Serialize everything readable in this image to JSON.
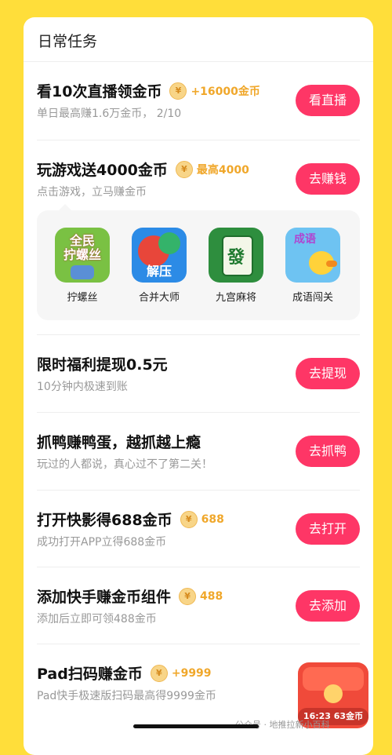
{
  "section_title": "日常任务",
  "tasks": [
    {
      "title": "看10次直播领金币",
      "reward": "+16000金币",
      "subtitle": "单日最高赚1.6万金币， 2/10",
      "button": "看直播"
    },
    {
      "title": "玩游戏送4000金币",
      "reward": "最高4000",
      "subtitle": "点击游戏，立马赚金币",
      "button": "去赚钱"
    },
    {
      "title": "限时福利提现0.5元",
      "reward": "",
      "subtitle": "10分钟内极速到账",
      "button": "去提现"
    },
    {
      "title": "抓鸭赚鸭蛋，越抓越上瘾",
      "reward": "",
      "subtitle": "玩过的人都说，真心过不了第二关！",
      "button": "去抓鸭"
    },
    {
      "title": "打开快影得688金币",
      "reward": "688",
      "subtitle": "成功打开APP立得688金币",
      "button": "去打开"
    },
    {
      "title": "添加快手赚金币组件",
      "reward": "488",
      "subtitle": "添加后立即可领488金币",
      "button": "去添加"
    },
    {
      "title": "Pad扫码赚金币",
      "reward": "+9999",
      "subtitle": "Pad快手极速版扫码最高得9999金币",
      "button": ""
    }
  ],
  "games": [
    {
      "label": "拧螺丝",
      "icon": "screw-game-icon",
      "icon_text": "全民\n拧螺丝"
    },
    {
      "label": "合并大师",
      "icon": "merge-game-icon",
      "icon_text": "解压"
    },
    {
      "label": "九宫麻将",
      "icon": "mahjong-game-icon",
      "icon_text": "發"
    },
    {
      "label": "成语闯关",
      "icon": "idiom-game-icon",
      "icon_text": "成语"
    }
  ],
  "coin_symbol": "¥",
  "redpack_timer": "16:23 63金币",
  "watermark": "公众号 · 地推拉新小百科",
  "colors": {
    "accent": "#FE3666",
    "coin": "#F0A72A",
    "background": "#FFDE3A"
  }
}
